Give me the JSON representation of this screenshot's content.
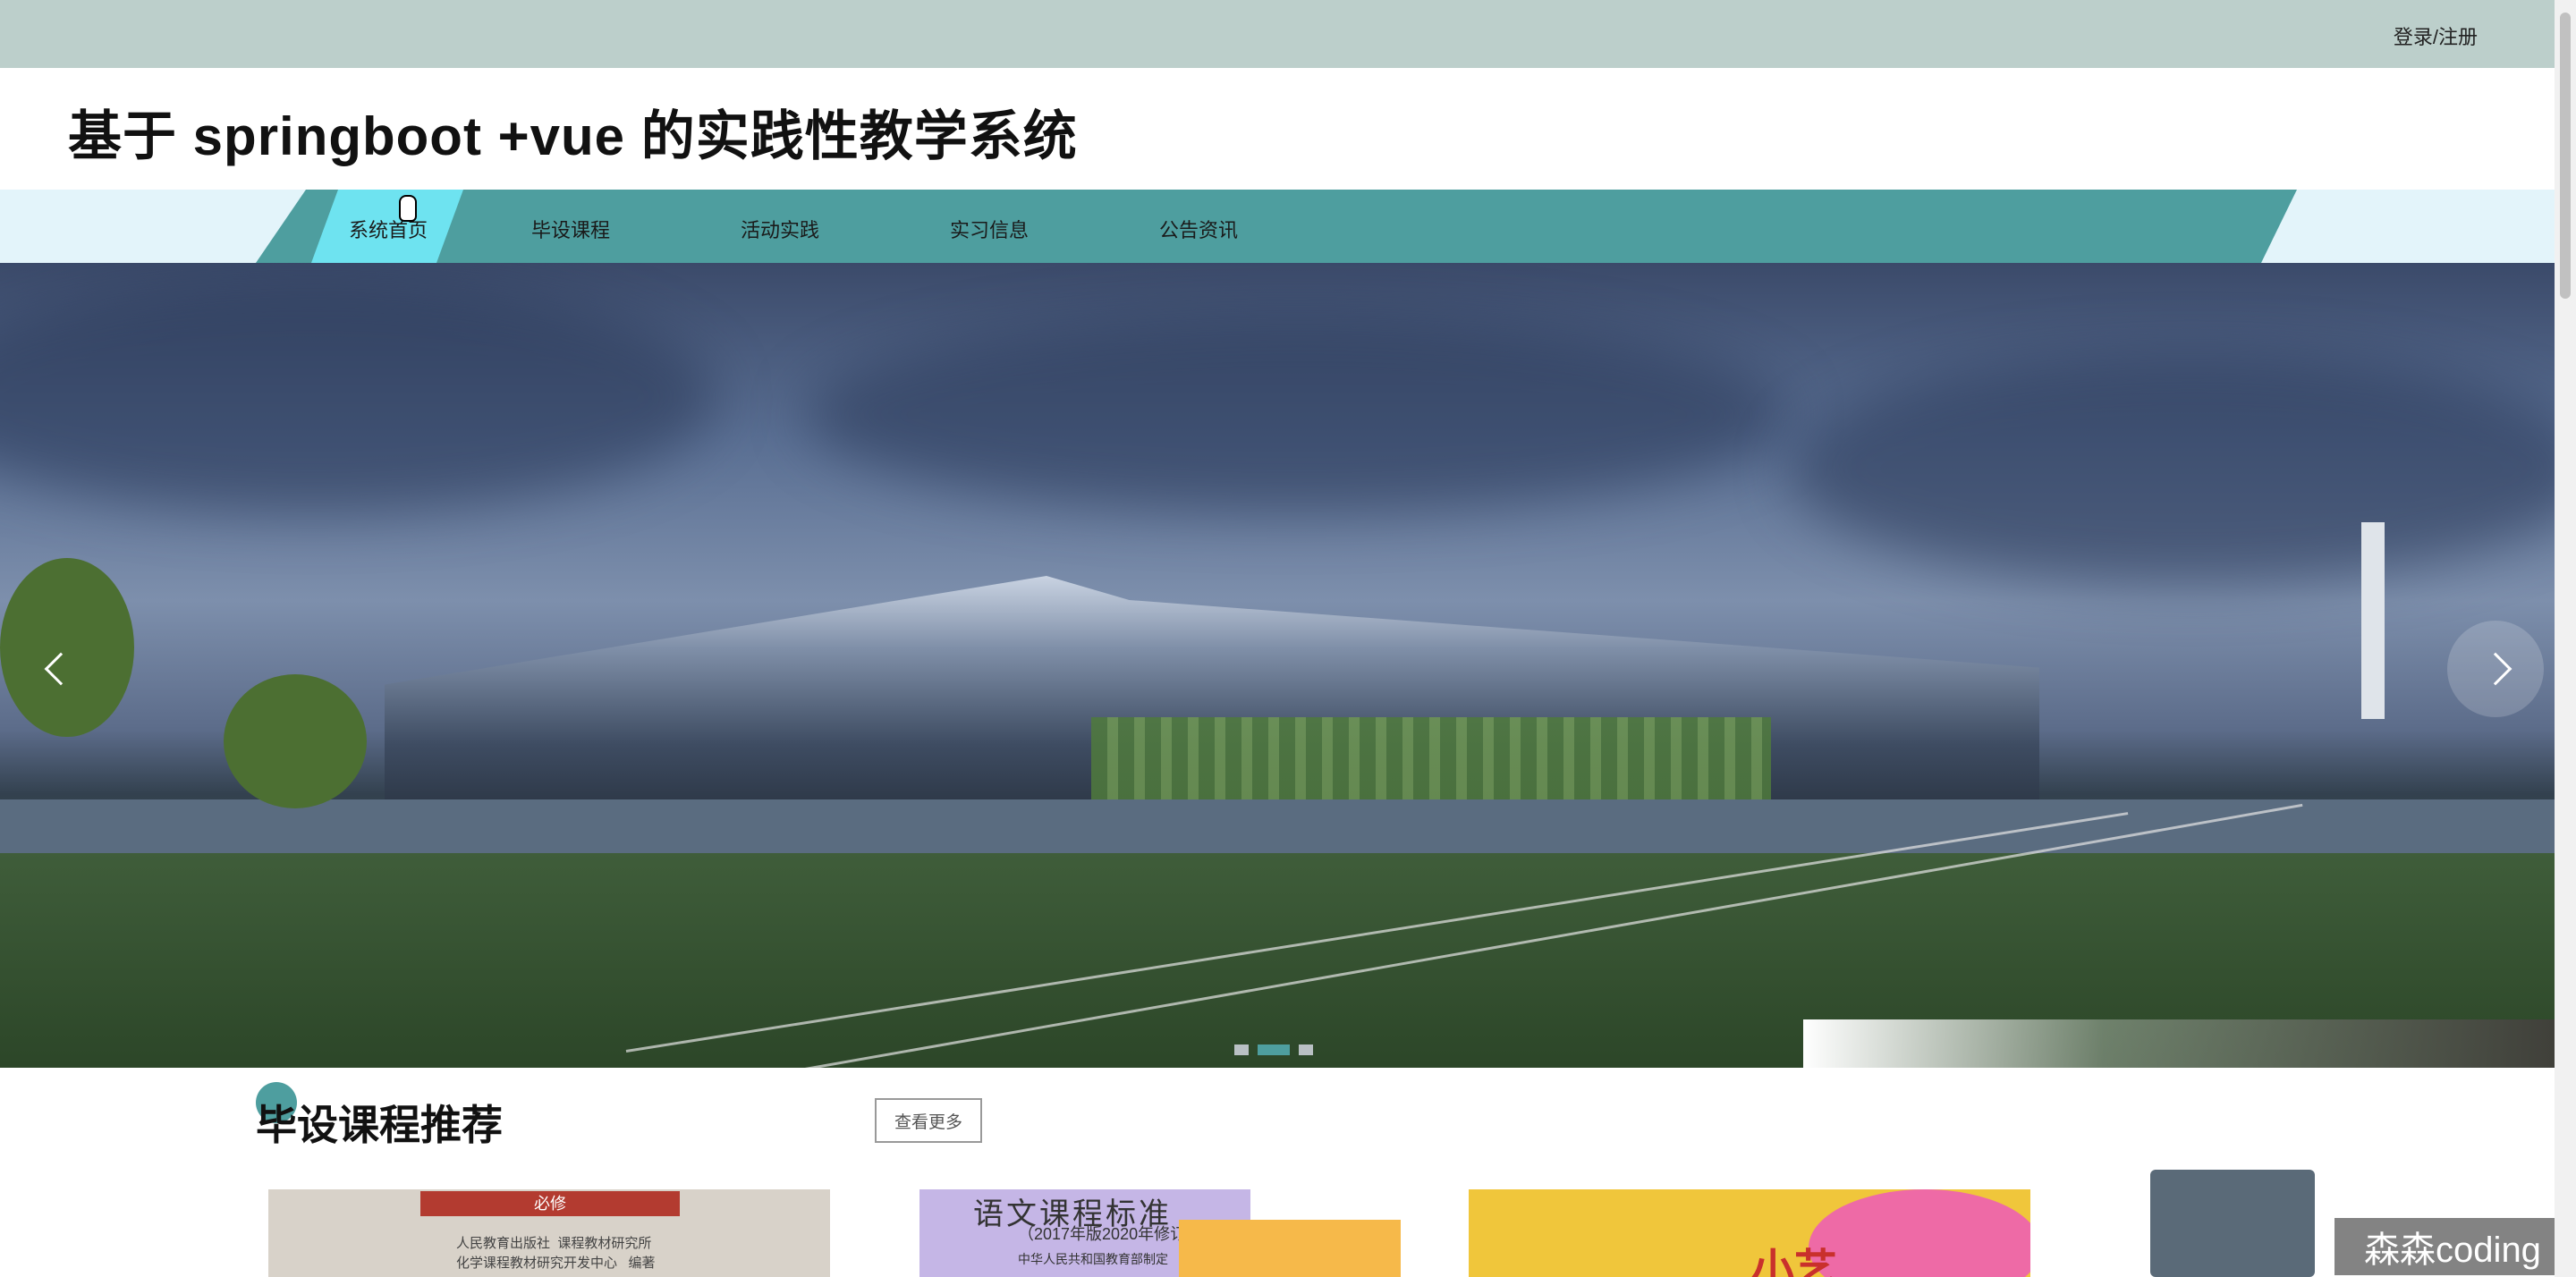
{
  "header": {
    "login_label": "登录/注册",
    "site_title": "基于 springboot +vue 的实践性教学系统"
  },
  "nav": {
    "items": [
      {
        "label": "系统首页",
        "active": true
      },
      {
        "label": "毕设课程"
      },
      {
        "label": "活动实践"
      },
      {
        "label": "实习信息"
      },
      {
        "label": "公告资讯"
      }
    ]
  },
  "carousel": {
    "slide_count": 3,
    "active_index": 1,
    "prev_icon": "chevron-left-icon",
    "next_icon": "chevron-right-icon"
  },
  "section": {
    "title": "毕设课程推荐",
    "more_label": "查看更多"
  },
  "cards": [
    {
      "top_label": "必修",
      "cover_text": "人民教育出版社  课程教材研究所\n化学课程教材研究开发中心   编著"
    },
    {
      "cover_title": "语文课程标准",
      "cover_year": "（2017年版2020年修订）",
      "cover_publisher": "中华人民共和国教育部制定"
    },
    {
      "cover_big": "小艺"
    }
  ],
  "watermark": "森森coding",
  "colors": {
    "topbar": "#bccfcb",
    "nav": "#4e9e9f",
    "nav_active": "#6ee3f0",
    "accent": "#4e9e9f"
  }
}
